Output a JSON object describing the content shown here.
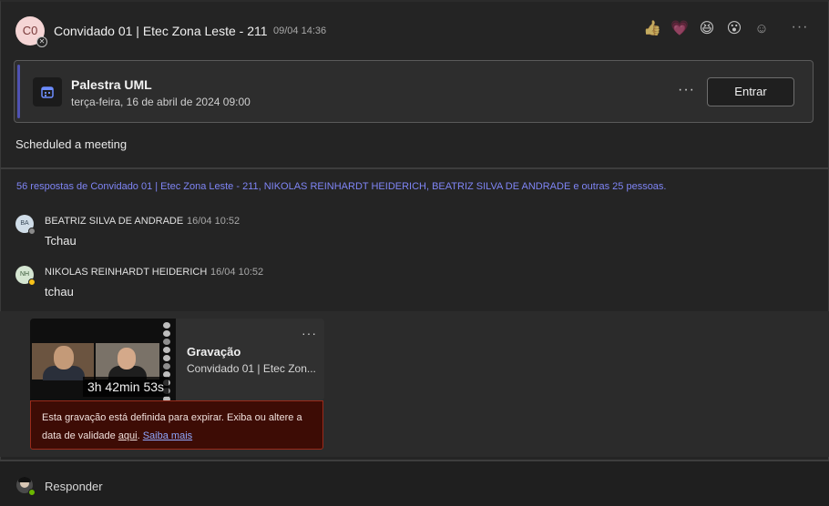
{
  "post": {
    "avatar_initials": "C0",
    "author": "Convidado 01 | Etec Zona Leste - 211",
    "timestamp": "09/04 14:36",
    "reactions": [
      "like-icon",
      "heart-icon",
      "laugh-icon",
      "surprised-icon",
      "add-reaction-icon"
    ]
  },
  "meeting": {
    "title": "Palestra UML",
    "date": "terça-feira, 16 de abril de 2024 09:00",
    "join_label": "Entrar",
    "icon": "calendar-icon"
  },
  "scheduled_text": "Scheduled a meeting",
  "replies_summary": "56 respostas de Convidado 01 | Etec Zona Leste - 211, NIKOLAS REINHARDT HEIDERICH, BEATRIZ SILVA DE ANDRADE e outras 25 pessoas.",
  "replies": [
    {
      "initials": "BA",
      "name": "BEATRIZ SILVA DE ANDRADE",
      "time": "16/04 10:52",
      "text": "Tchau",
      "avatar_color": "#d0dde8",
      "status_color": "#8a8a8a"
    },
    {
      "initials": "NH",
      "name": "NIKOLAS REINHARDT HEIDERICH",
      "time": "16/04 10:52",
      "text": "tchau",
      "avatar_color": "#d5e6d2",
      "status_color": "#f8c219"
    }
  ],
  "recording": {
    "duration": "3h 42min 53s",
    "title": "Gravação",
    "subtitle": "Convidado 01 | Etec Zon...",
    "warning_text": "Esta gravação está definida para expirar. Exiba ou altere a data de validade",
    "warning_link1": "aqui",
    "warning_sep": ".",
    "warning_link2": "Saiba mais"
  },
  "reply_bar": {
    "label": "Responder",
    "status_color": "#6bb700"
  },
  "colors": {
    "accent": "#4f52b2",
    "link": "#7f85f5",
    "warning_bg": "#3d0c05",
    "warning_border": "#9a2a1a"
  }
}
